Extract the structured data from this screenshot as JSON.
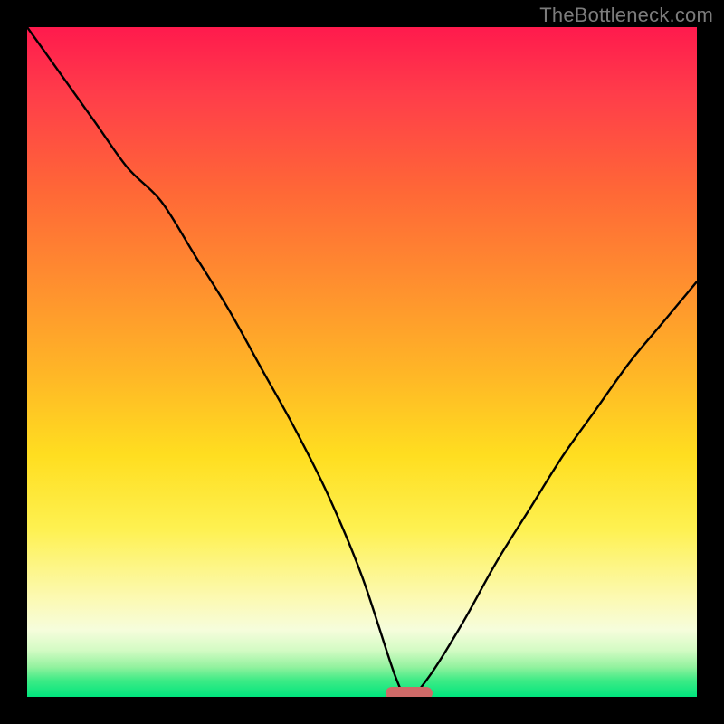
{
  "watermark": "TheBottleneck.com",
  "chart_data": {
    "type": "line",
    "title": "",
    "xlabel": "",
    "ylabel": "",
    "xlim": [
      0,
      100
    ],
    "ylim": [
      0,
      100
    ],
    "grid": false,
    "x": [
      0,
      5,
      10,
      15,
      20,
      25,
      30,
      35,
      40,
      45,
      50,
      55,
      57,
      60,
      65,
      70,
      75,
      80,
      85,
      90,
      95,
      100
    ],
    "y": [
      100,
      93,
      86,
      79,
      74,
      66,
      58,
      49,
      40,
      30,
      18,
      3,
      0,
      3,
      11,
      20,
      28,
      36,
      43,
      50,
      56,
      62
    ],
    "min_point": {
      "x": 57,
      "y": 0
    },
    "gradient_stops": [
      {
        "pos": 0,
        "color": "#ff1a4d"
      },
      {
        "pos": 0.64,
        "color": "#ffde20"
      },
      {
        "pos": 0.9,
        "color": "#f6fddc"
      },
      {
        "pos": 1.0,
        "color": "#00e57d"
      }
    ],
    "marker_color": "#cf6a68"
  }
}
